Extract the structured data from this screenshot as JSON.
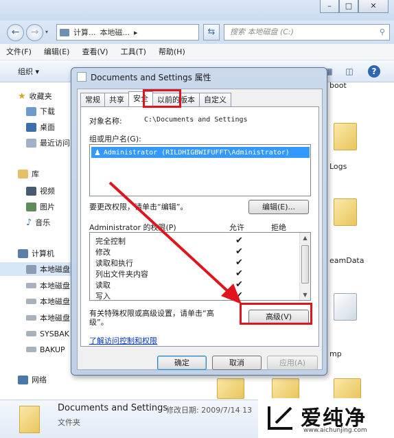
{
  "titlebar": {
    "minimize": "–",
    "maximize": "□",
    "close": "✕"
  },
  "navbar": {
    "address_parts": [
      "计算...",
      "本地磁...",
      "▸"
    ],
    "refresh": "⇆",
    "search_placeholder": "搜索 本地磁盘 (C:)"
  },
  "menubar": [
    "文件(F)",
    "编辑(E)",
    "查看(V)",
    "工具(T)",
    "帮助(H)"
  ],
  "toolbar": {
    "organize": "组织 ▾"
  },
  "sidebar": {
    "favorites": "收藏夹",
    "downloads": "下载",
    "desktop": "桌面",
    "recent": "最近访问",
    "libraries": "库",
    "videos": "视频",
    "pictures": "图片",
    "music": "音乐",
    "computer": "计算机",
    "drives": [
      "本地磁盘",
      "本地磁盘",
      "本地磁盘",
      "本地磁盘",
      "SYSBAK",
      "BAKUP"
    ],
    "network": "网络"
  },
  "right_pane": {
    "labels": [
      "boot",
      "Logs",
      "eamData",
      "mp"
    ]
  },
  "details": {
    "name": "Documents and Settings",
    "modified": "修改日期: 2009/7/14 13",
    "type": "文件夹"
  },
  "dialog": {
    "title": "Documents and Settings 属性",
    "tabs": [
      "常规",
      "共享",
      "安全",
      "以前的版本",
      "自定义"
    ],
    "object_name_label": "对象名称:",
    "object_name_value": "C:\\Documents and Settings",
    "groups_label": "组或用户名(G):",
    "user_entry": "Administrator (RILDHIGBWIFUFFT\\Administrator)",
    "change_hint": "要更改权限，请单击“编辑”。",
    "edit_button": "编辑(E)...",
    "perm_header": "Administrator 的权限(P)",
    "allow_col": "允许",
    "deny_col": "拒绝",
    "permissions": [
      {
        "name": "完全控制",
        "allow": "✔"
      },
      {
        "name": "修改",
        "allow": "✔"
      },
      {
        "name": "读取和执行",
        "allow": "✔"
      },
      {
        "name": "列出文件夹内容",
        "allow": "✔"
      },
      {
        "name": "读取",
        "allow": "✔"
      },
      {
        "name": "写入",
        "allow": "✔"
      }
    ],
    "advanced_hint_1": "有关特殊权限或高级设置，请单击“高",
    "advanced_hint_2": "级”。",
    "advanced_button": "高级(V)",
    "learn_link": "了解访问控制和权限",
    "ok": "确定",
    "cancel": "取消",
    "apply": "应用(A)"
  },
  "watermark": {
    "brand": "爱纯净",
    "url": "www.aichunjing.com"
  },
  "colors": {
    "highlight": "#e0141c",
    "selection": "#3399ff"
  }
}
